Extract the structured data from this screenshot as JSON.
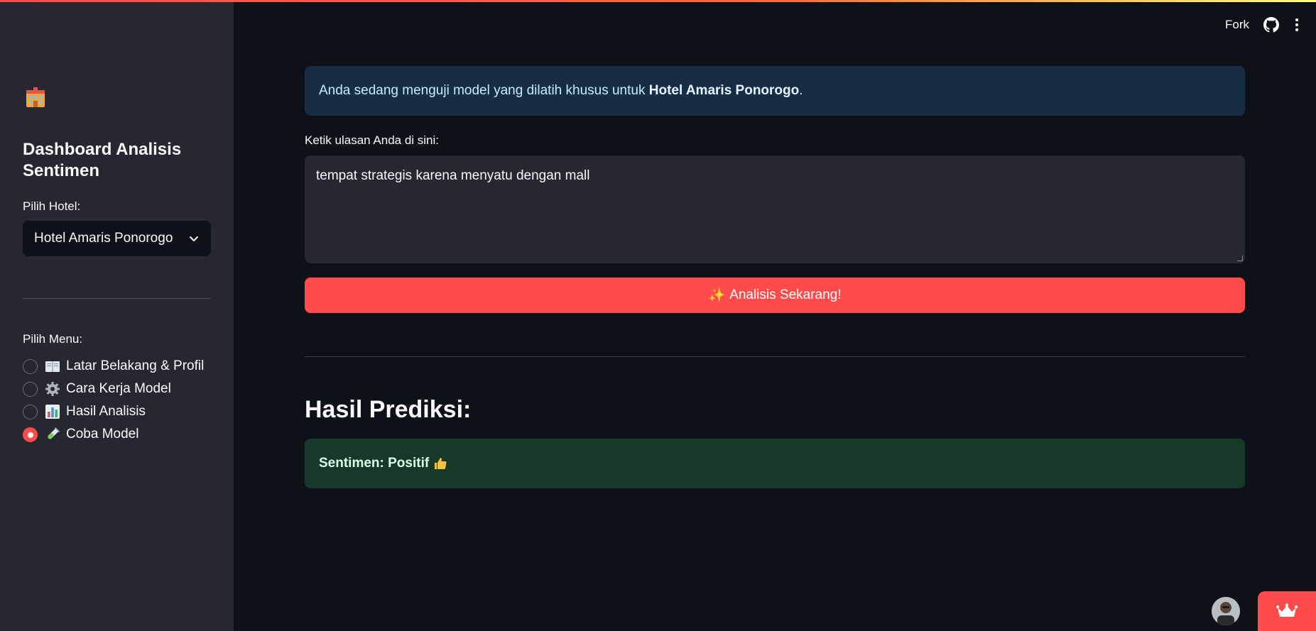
{
  "sidebar": {
    "logo_icon": "hotel-emoji-icon",
    "title": "Dashboard Analisis Sentimen",
    "hotel_label": "Pilih Hotel:",
    "hotel_selected": "Hotel Amaris Ponorogo",
    "menu_label": "Pilih Menu:",
    "menu_items": [
      {
        "label": "Latar Belakang & Profil",
        "icon": "book-icon",
        "checked": false
      },
      {
        "label": "Cara Kerja Model",
        "icon": "gear-icon",
        "checked": false
      },
      {
        "label": "Hasil Analisis",
        "icon": "bar-chart-icon",
        "checked": false
      },
      {
        "label": "Coba Model",
        "icon": "test-tube-icon",
        "checked": true
      }
    ]
  },
  "header": {
    "fork_label": "Fork"
  },
  "main": {
    "info_prefix": "Anda sedang menguji model yang dilatih khusus untuk ",
    "info_hotel": "Hotel Amaris Ponorogo",
    "info_suffix": ".",
    "input_label": "Ketik ulasan Anda di sini:",
    "input_value": "tempat strategis karena menyatu dengan mall",
    "button_emoji": "✨",
    "button_label": "Analisis Sekarang!",
    "result_title": "Hasil Prediksi:",
    "result_text": "Sentimen: Positif"
  },
  "colors": {
    "accent": "#ff4b4b",
    "info_bg": "#172d43",
    "success_bg": "#173928",
    "sidebar_bg": "#262730",
    "app_bg": "#0e1117"
  }
}
